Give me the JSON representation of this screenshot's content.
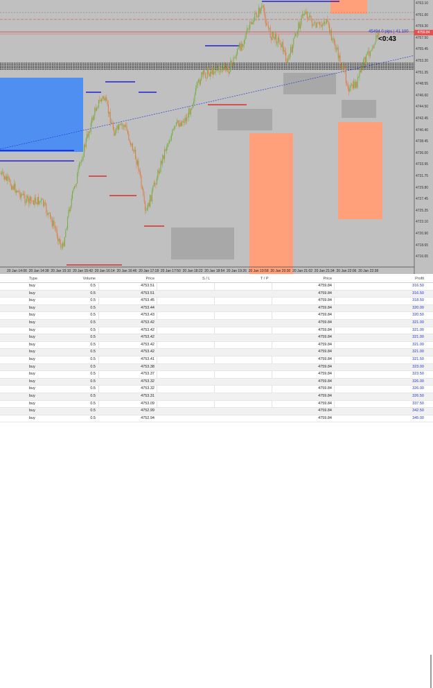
{
  "chart": {
    "y_axis_labels": [
      "4763.10",
      "4761.00",
      "4759.30",
      "4757.50",
      "4755.45",
      "4753.20",
      "4751.35",
      "4748.55",
      "4746.60",
      "4744.50",
      "4742.45",
      "4740.40",
      "4738.45",
      "4736.00",
      "4733.95",
      "4731.75",
      "4729.80",
      "4727.45",
      "4725.25",
      "4723.10",
      "4720.90",
      "4718.65",
      "4716.65"
    ],
    "x_axis_labels": [
      "20 Jan 14:06",
      "20 Jan 14:38",
      "20 Jan 15:10",
      "20 Jan 15:42",
      "20 Jan 16:14",
      "20 Jan 16:46",
      "20 Jan 17:18",
      "20 Jan 17:50",
      "20 Jan 18:22",
      "20 Jan 18:54",
      "20 Jan 19:26",
      "20 Jan 19:58",
      "20 Jan 20:30",
      "20 Jan 21:02",
      "20 Jan 21:34",
      "20 Jan 22:06",
      "20 Jan 22:38"
    ],
    "position_label": "45494.0 pips | 41.100",
    "price_tag": "4759.84",
    "timer": "<0:43",
    "colors": {
      "background": "#c0c0c0",
      "bull": "#6fae3c",
      "bear": "#e07a3a",
      "zone_blue": "#4f8ff2",
      "zone_orange": "#ffa07a",
      "zone_gray": "#a8a8a8",
      "level_blue": "#0000cc",
      "level_red": "#dd1111"
    }
  },
  "table": {
    "headers": {
      "type": "Type",
      "volume": "Volume",
      "price": "Price",
      "sl": "S / L",
      "tp": "T / P",
      "current_price": "Price",
      "profit": "Profit"
    },
    "rows": [
      {
        "type": "buy",
        "volume": "0.5",
        "price": "4753.51",
        "sl": "",
        "tp": "",
        "current_price": "4759.84",
        "profit": "316.50"
      },
      {
        "type": "buy",
        "volume": "0.5",
        "price": "4753.51",
        "sl": "",
        "tp": "",
        "current_price": "4759.84",
        "profit": "316.50"
      },
      {
        "type": "buy",
        "volume": "0.5",
        "price": "4753.45",
        "sl": "",
        "tp": "",
        "current_price": "4759.84",
        "profit": "318.50"
      },
      {
        "type": "buy",
        "volume": "0.5",
        "price": "4753.44",
        "sl": "",
        "tp": "",
        "current_price": "4759.84",
        "profit": "320.00"
      },
      {
        "type": "buy",
        "volume": "0.5",
        "price": "4753.43",
        "sl": "",
        "tp": "",
        "current_price": "4759.84",
        "profit": "320.50"
      },
      {
        "type": "buy",
        "volume": "0.5",
        "price": "4753.42",
        "sl": "",
        "tp": "",
        "current_price": "4759.84",
        "profit": "321.00"
      },
      {
        "type": "buy",
        "volume": "0.5",
        "price": "4753.42",
        "sl": "",
        "tp": "",
        "current_price": "4759.84",
        "profit": "321.00"
      },
      {
        "type": "buy",
        "volume": "0.5",
        "price": "4753.42",
        "sl": "",
        "tp": "",
        "current_price": "4759.84",
        "profit": "321.00"
      },
      {
        "type": "buy",
        "volume": "0.5",
        "price": "4753.42",
        "sl": "",
        "tp": "",
        "current_price": "4759.84",
        "profit": "321.00"
      },
      {
        "type": "buy",
        "volume": "0.5",
        "price": "4753.42",
        "sl": "",
        "tp": "",
        "current_price": "4759.84",
        "profit": "321.00"
      },
      {
        "type": "buy",
        "volume": "0.5",
        "price": "4753.41",
        "sl": "",
        "tp": "",
        "current_price": "4759.84",
        "profit": "321.50"
      },
      {
        "type": "buy",
        "volume": "0.5",
        "price": "4753.38",
        "sl": "",
        "tp": "",
        "current_price": "4759.84",
        "profit": "323.00"
      },
      {
        "type": "buy",
        "volume": "0.5",
        "price": "4753.37",
        "sl": "",
        "tp": "",
        "current_price": "4759.84",
        "profit": "323.50"
      },
      {
        "type": "buy",
        "volume": "0.5",
        "price": "4753.32",
        "sl": "",
        "tp": "",
        "current_price": "4759.84",
        "profit": "326.00"
      },
      {
        "type": "buy",
        "volume": "0.5",
        "price": "4753.32",
        "sl": "",
        "tp": "",
        "current_price": "4759.84",
        "profit": "326.00"
      },
      {
        "type": "buy",
        "volume": "0.5",
        "price": "4753.31",
        "sl": "",
        "tp": "",
        "current_price": "4759.84",
        "profit": "326.50"
      },
      {
        "type": "buy",
        "volume": "0.5",
        "price": "4753.09",
        "sl": "",
        "tp": "",
        "current_price": "4759.84",
        "profit": "337.50"
      },
      {
        "type": "buy",
        "volume": "0.5",
        "price": "4752.99",
        "sl": "",
        "tp": "",
        "current_price": "4759.84",
        "profit": "342.50"
      },
      {
        "type": "buy",
        "volume": "0.5",
        "price": "4752.94",
        "sl": "",
        "tp": "",
        "current_price": "4759.84",
        "profit": "345.00"
      }
    ]
  }
}
